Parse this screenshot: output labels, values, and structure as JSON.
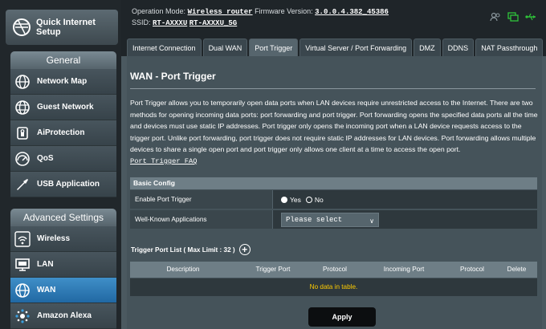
{
  "sidebar": {
    "quick_setup": "Quick Internet Setup",
    "general_title": "General",
    "general_items": [
      {
        "label": "Network Map",
        "icon": "globe-icon"
      },
      {
        "label": "Guest Network",
        "icon": "globe-network-icon"
      },
      {
        "label": "AiProtection",
        "icon": "lock-icon"
      },
      {
        "label": "QoS",
        "icon": "gauge-icon"
      },
      {
        "label": "USB Application",
        "icon": "puzzle-icon"
      }
    ],
    "advanced_title": "Advanced Settings",
    "advanced_items": [
      {
        "label": "Wireless",
        "icon": "wifi-icon"
      },
      {
        "label": "LAN",
        "icon": "monitor-icon"
      },
      {
        "label": "WAN",
        "icon": "globe-icon"
      },
      {
        "label": "Amazon Alexa",
        "icon": "alexa-icon"
      }
    ]
  },
  "header": {
    "operation_mode_label": "Operation Mode:",
    "operation_mode_value": "Wireless router",
    "firmware_label": "Firmware Version:",
    "firmware_value": "3.0.0.4.382_45386",
    "ssid_label": "SSID:",
    "ssid_1": "RT-AXXXU",
    "ssid_2": "RT-AXXXU_5G"
  },
  "tabs": [
    {
      "label": "Internet Connection",
      "active": false
    },
    {
      "label": "Dual WAN",
      "active": false
    },
    {
      "label": "Port Trigger",
      "active": true
    },
    {
      "label": "Virtual Server / Port Forwarding",
      "active": false
    },
    {
      "label": "DMZ",
      "active": false
    },
    {
      "label": "DDNS",
      "active": false
    },
    {
      "label": "NAT Passthrough",
      "active": false
    }
  ],
  "page": {
    "title": "WAN - Port Trigger",
    "description": "Port Trigger allows you to temporarily open data ports when LAN devices require unrestricted access to the Internet. There are two methods for opening incoming data ports: port forwarding and port trigger. Port forwarding opens the specified data ports all the time and devices must use static IP addresses. Port trigger only opens the incoming port when a LAN device requests access to the trigger port. Unlike port forwarding, port trigger does not require static IP addresses for LAN devices. Port forwarding allows multiple devices to share a single open port and port trigger only allows one client at a time to access the open port.",
    "faq_link": "Port Trigger FAQ",
    "basic_config_title": "Basic Config",
    "enable_label": "Enable Port Trigger",
    "radio_yes": "Yes",
    "radio_no": "No",
    "enable_value": "No",
    "well_known_label": "Well-Known Applications",
    "well_known_value": "Please select",
    "trigger_list_label": "Trigger Port List ( Max Limit : 32 )",
    "columns": [
      "Description",
      "Trigger Port",
      "Protocol",
      "Incoming Port",
      "Protocol",
      "Delete"
    ],
    "no_data": "No data in table.",
    "apply": "Apply"
  },
  "colors": {
    "active_nav": "#2168a3",
    "no_data": "#ffcc00"
  }
}
